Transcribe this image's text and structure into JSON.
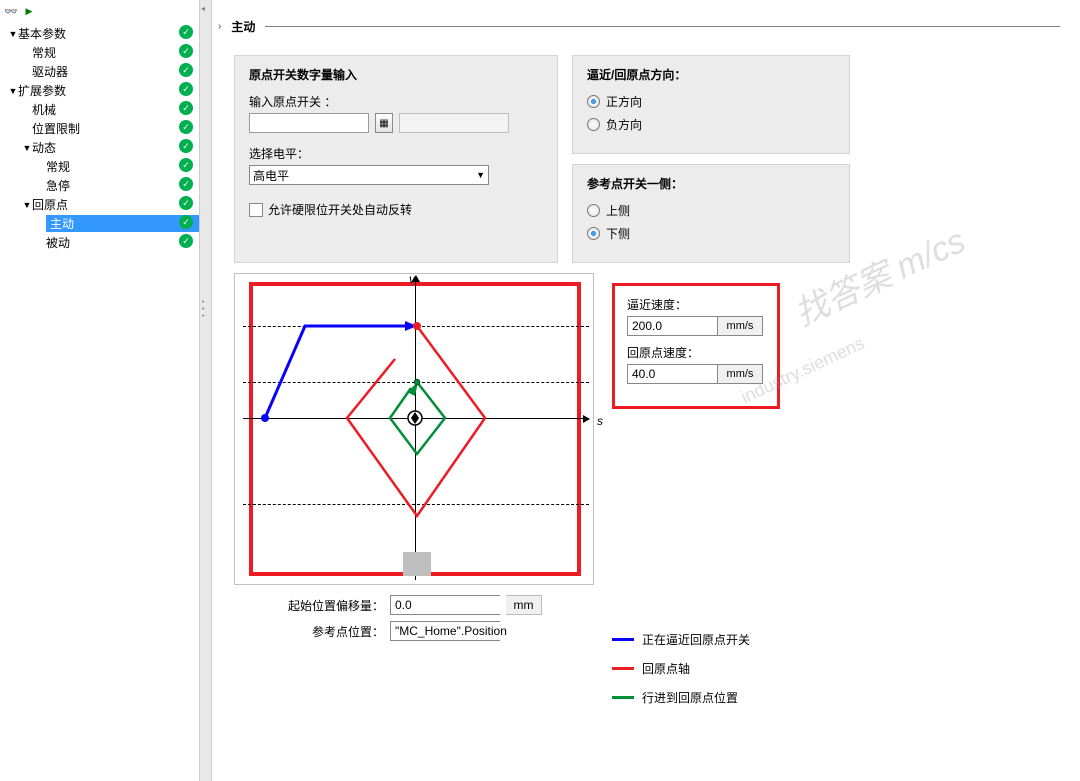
{
  "tree": [
    {
      "label": "基本参数",
      "level": 0,
      "caret": "▼",
      "check": true
    },
    {
      "label": "常规",
      "level": 1,
      "caret": "",
      "check": true
    },
    {
      "label": "驱动器",
      "level": 1,
      "caret": "",
      "check": true
    },
    {
      "label": "扩展参数",
      "level": 0,
      "caret": "▼",
      "check": true
    },
    {
      "label": "机械",
      "level": 1,
      "caret": "",
      "check": true
    },
    {
      "label": "位置限制",
      "level": 1,
      "caret": "",
      "check": true
    },
    {
      "label": "动态",
      "level": 1,
      "caret": "▼",
      "check": true
    },
    {
      "label": "常规",
      "level": 2,
      "caret": "",
      "check": true
    },
    {
      "label": "急停",
      "level": 2,
      "caret": "",
      "check": true
    },
    {
      "label": "回原点",
      "level": 1,
      "caret": "▼",
      "check": true
    },
    {
      "label": "主动",
      "level": 2,
      "caret": "",
      "check": true,
      "selected": true
    },
    {
      "label": "被动",
      "level": 2,
      "caret": "",
      "check": true
    }
  ],
  "section_title": "主动",
  "origin_switch": {
    "title": "原点开关数字量输入",
    "input_label": "输入原点开关 ：",
    "input_value": "",
    "level_label": "选择电平：",
    "level_value": "高电平",
    "auto_reverse": "允许硬限位开关处自动反转"
  },
  "direction": {
    "title": "逼近/回原点方向：",
    "pos": "正方向",
    "neg": "负方向",
    "selected": "pos"
  },
  "ref_side": {
    "title": "参考点开关一侧：",
    "upper": "上侧",
    "lower": "下侧",
    "selected": "lower"
  },
  "speeds": {
    "approach_label": "逼近速度：",
    "approach_value": "200.0",
    "approach_unit": "mm/s",
    "home_label": "回原点速度：",
    "home_value": "40.0",
    "home_unit": "mm/s"
  },
  "legend": {
    "blue": "正在逼近回原点开关",
    "red": "回原点轴",
    "green": "行进到回原点位置"
  },
  "bottom": {
    "offset_label": "起始位置偏移量：",
    "offset_value": "0.0",
    "offset_unit": "mm",
    "ref_label": "参考点位置：",
    "ref_value": "\"MC_Home\".Position"
  }
}
